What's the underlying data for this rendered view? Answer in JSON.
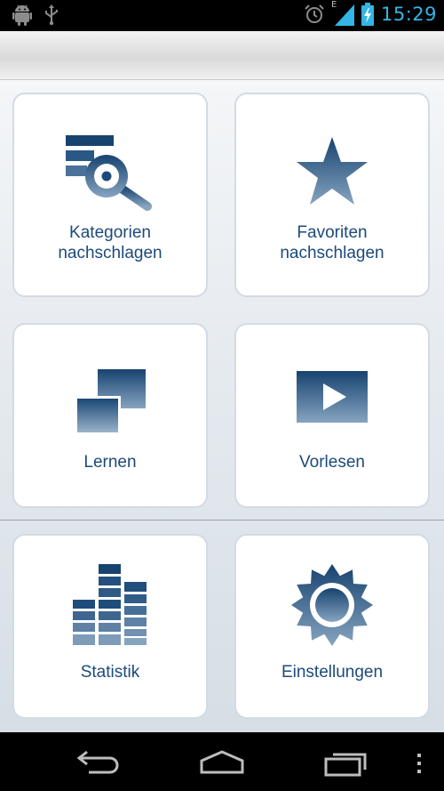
{
  "status_bar": {
    "time": "15:29",
    "network_type": "E",
    "icons": [
      "android-icon",
      "usb-icon",
      "alarm-icon",
      "signal-icon",
      "battery-charging-icon"
    ]
  },
  "tiles": [
    {
      "label_line1": "Kategorien",
      "label_line2": "nachschlagen",
      "icon": "category-search-icon"
    },
    {
      "label_line1": "Favoriten",
      "label_line2": "nachschlagen",
      "icon": "star-icon"
    },
    {
      "label_line1": "Lernen",
      "icon": "cards-icon"
    },
    {
      "label_line1": "Vorlesen",
      "icon": "play-icon"
    },
    {
      "label_line1": "Statistik",
      "icon": "bar-chart-icon"
    },
    {
      "label_line1": "Einstellungen",
      "icon": "gear-icon"
    }
  ],
  "colors": {
    "accent": "#1c4a7b",
    "icon_dark": "#17436f",
    "icon_light": "#7f9dba",
    "status_blue": "#33b5e5"
  },
  "nav_bar": {
    "icons": [
      "back-icon",
      "home-icon",
      "recent-apps-icon",
      "menu-icon"
    ]
  }
}
